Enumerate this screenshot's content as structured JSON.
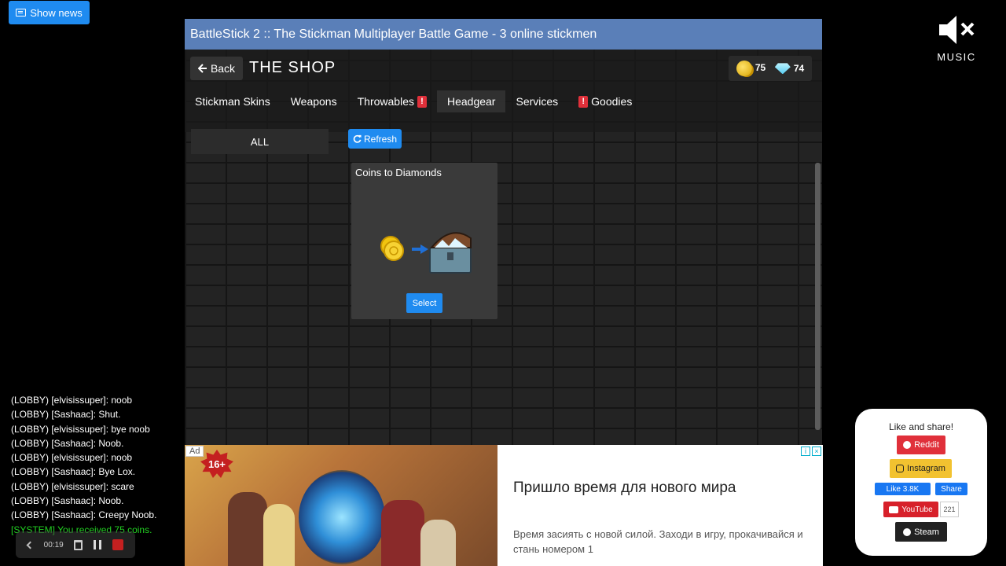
{
  "news": {
    "label": "Show news"
  },
  "music": {
    "label": "MUSIC",
    "icon": "speaker-muted-icon"
  },
  "game": {
    "title": "BattleStick 2 :: The Stickman Multiplayer Battle Game - 3 online stickmen",
    "back_label": "Back",
    "shop_title": "THE SHOP",
    "coins": "75",
    "diamonds": "74",
    "tabs": [
      {
        "label": "Stickman Skins",
        "alert_before": false,
        "alert_after": false
      },
      {
        "label": "Weapons",
        "alert_before": false,
        "alert_after": false
      },
      {
        "label": "Throwables",
        "alert_before": false,
        "alert_after": true
      },
      {
        "label": "Headgear",
        "alert_before": false,
        "alert_after": false,
        "active": true
      },
      {
        "label": "Services",
        "alert_before": false,
        "alert_after": false
      },
      {
        "label": "Goodies",
        "alert_before": true,
        "alert_after": false
      }
    ],
    "alert_mark": "!",
    "category": "ALL",
    "refresh_label": "Refresh",
    "card": {
      "title": "Coins to Diamonds",
      "select_label": "Select"
    }
  },
  "ad": {
    "tag": "Ad",
    "age": "16+",
    "headline": "Пришло время для нового мира",
    "text": "Время засиять с новой силой. Заходи в игру, прокачивайся и стань номером 1"
  },
  "chat": [
    "(LOBBY) [elvisissuper]: noob",
    "(LOBBY) [Sashaac]: Shut.",
    "(LOBBY) [elvisissuper]: bye noob",
    "(LOBBY) [Sashaac]: Noob.",
    "(LOBBY) [elvisissuper]: noob",
    "(LOBBY) [Sashaac]: Bye Lox.",
    "(LOBBY) [elvisissuper]: scare",
    "(LOBBY) [Sashaac]: Noob.",
    "(LOBBY) [Sashaac]: Creepy Noob."
  ],
  "chat_system": "[SYSTEM] You received 75 coins.",
  "recorder": {
    "time": "00:19"
  },
  "share": {
    "title": "Like and share!",
    "reddit": "Reddit",
    "instagram": "Instagram",
    "fb_like": "Like 3.8K",
    "fb_share": "Share",
    "youtube": "YouTube",
    "youtube_count": "221",
    "steam": "Steam"
  },
  "colors": {
    "accent": "#1f8bf0",
    "titlebar": "#5a7fb8",
    "alert": "#e0303a",
    "system_chat": "#22d122"
  }
}
